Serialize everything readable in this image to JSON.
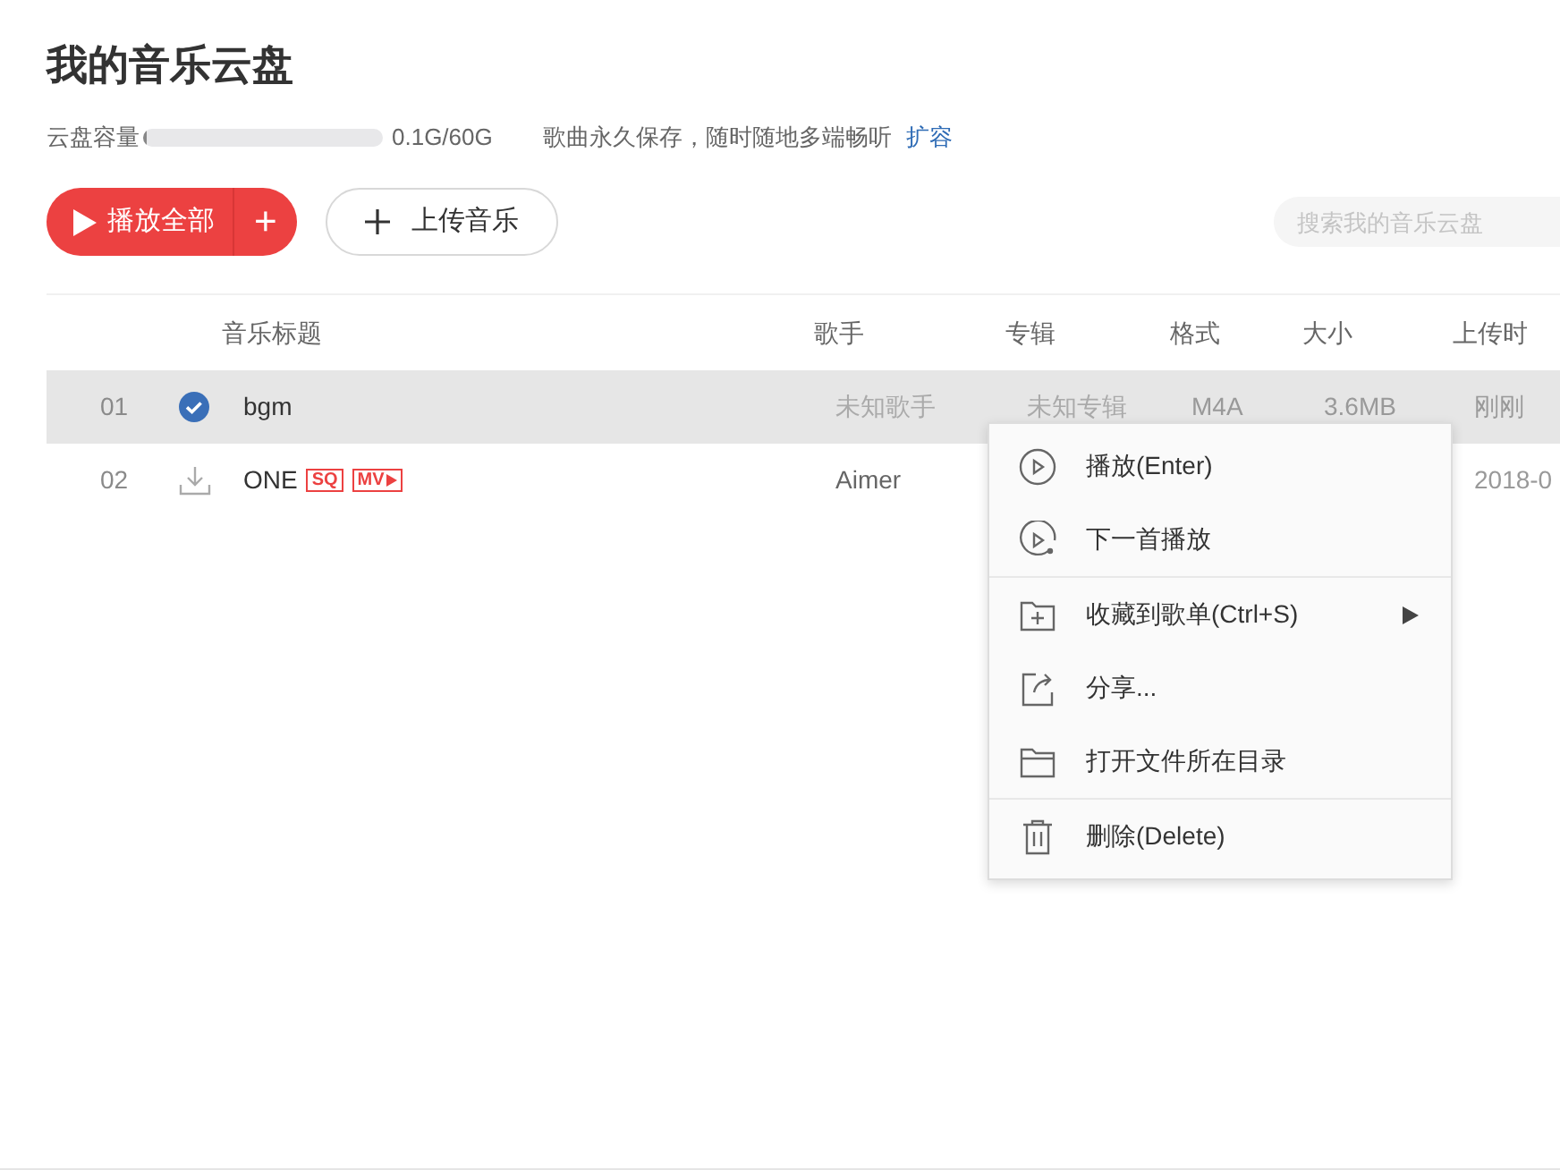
{
  "title": "我的音乐云盘",
  "storage": {
    "label": "云盘容量",
    "level": 0.01,
    "reading": "0.1G/60G",
    "note": "歌曲永久保存，随时随地多端畅听",
    "link": "扩容"
  },
  "toolbar": {
    "play_all": "播放全部",
    "add": "+",
    "upload": "上传音乐",
    "search": {
      "placeholder": "搜索我的音乐云盘"
    }
  },
  "table": {
    "columns": [
      "音乐标题",
      "歌手",
      "专辑",
      "格式",
      "大小",
      "上传时"
    ],
    "rows": [
      {
        "index": "01",
        "kind": "downloaded",
        "title": "bgm",
        "badges": [],
        "singer": "未知歌手",
        "album": "未知专辑",
        "format": "M4A",
        "size": "3.6MB",
        "uploaded": "刚刚",
        "selected": true
      },
      {
        "index": "02",
        "kind": "download",
        "title": "ONE",
        "badges": [
          "SQ",
          "MV"
        ],
        "singer": "Aimer",
        "uploaded": "2018-0",
        "selected": false
      }
    ]
  },
  "context_menu": {
    "groups": [
      [
        {
          "kind": "play",
          "label": "播放(Enter)",
          "submenu": false
        },
        {
          "kind": "next",
          "label": "下一首播放",
          "submenu": false
        }
      ],
      [
        {
          "kind": "collect",
          "label": "收藏到歌单(Ctrl+S)",
          "submenu": true
        },
        {
          "kind": "share",
          "label": "分享...",
          "submenu": false
        },
        {
          "kind": "folder",
          "label": "打开文件所在目录",
          "submenu": false
        }
      ],
      [
        {
          "kind": "delete",
          "label": "删除(Delete)",
          "submenu": false
        }
      ]
    ]
  }
}
